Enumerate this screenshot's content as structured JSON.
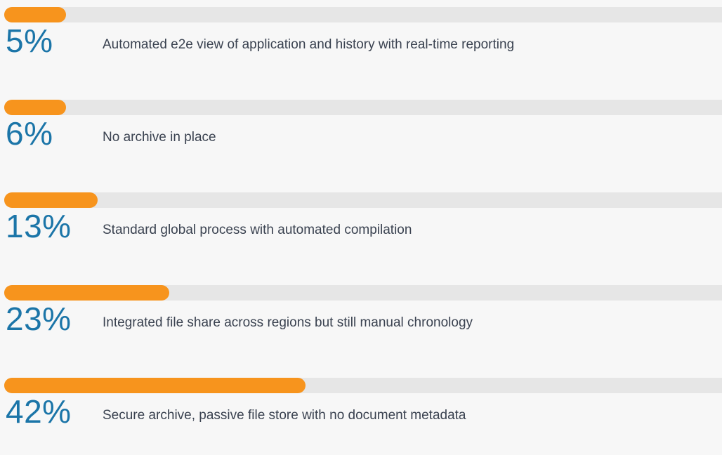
{
  "colors": {
    "background": "#f7f7f7",
    "track": "#e6e6e6",
    "bar": "#f7941d",
    "percent_text": "#1b75a8",
    "label_text": "#3a4250"
  },
  "chart_data": {
    "type": "bar",
    "orientation": "horizontal",
    "xlim": [
      0,
      100
    ],
    "grid": false,
    "legend": "none",
    "items": [
      {
        "value": 5,
        "value_label": "5%",
        "label": "Automated e2e view of application and history with real-time reporting"
      },
      {
        "value": 6,
        "value_label": "6%",
        "label": "No archive in place"
      },
      {
        "value": 13,
        "value_label": "13%",
        "label": "Standard global process with automated compilation"
      },
      {
        "value": 23,
        "value_label": "23%",
        "label": "Integrated file share across regions but still manual chronology"
      },
      {
        "value": 42,
        "value_label": "42%",
        "label": "Secure archive, passive file store with no document metadata"
      }
    ]
  }
}
